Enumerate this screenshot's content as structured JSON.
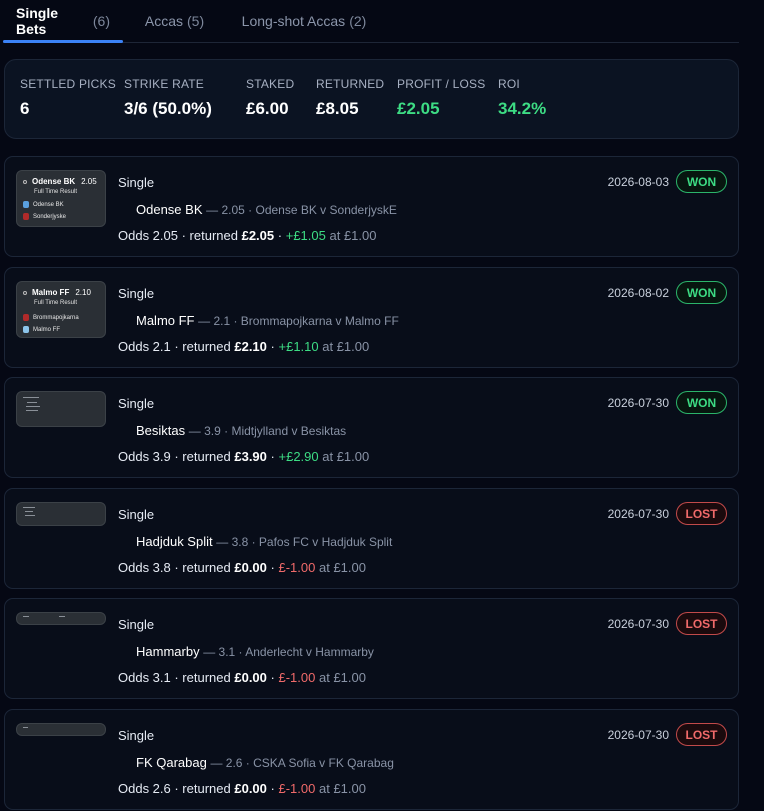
{
  "tabs": [
    {
      "label": "Single Bets",
      "count": "(6)"
    },
    {
      "label": "Accas",
      "count": "(5)"
    },
    {
      "label": "Long-shot Accas",
      "count": "(2)"
    }
  ],
  "summary": {
    "settled_label": "Settled Picks",
    "settled_value": "6",
    "strike_label": "Strike Rate",
    "strike_value": "3/6 (50.0%)",
    "staked_label": "Staked",
    "staked_value": "£6.00",
    "returned_label": "Returned",
    "returned_value": "£8.05",
    "pl_label": "Profit / Loss",
    "pl_value": "£2.05",
    "roi_label": "ROI",
    "roi_value": "34.2%"
  },
  "bets": [
    {
      "type": "Single",
      "date": "2026-08-03",
      "status": "WON",
      "selection": "Odense BK",
      "sel_odds": "— 2.05 · Odense BK v SonderjyskE",
      "odds_text": "Odds 2.05 · returned",
      "returned": "£2.05",
      "dot": "·",
      "pnl": "+£1.05",
      "stake_text": "at £1.00",
      "thumb": {
        "title": "Odense BK",
        "odds": "2.05",
        "result": "Full Time Result",
        "team1": "Odense BK",
        "team2": "Sonderjyske"
      }
    },
    {
      "type": "Single",
      "date": "2026-08-02",
      "status": "WON",
      "selection": "Malmo FF",
      "sel_odds": "— 2.1 · Brommapojkarna v Malmo FF",
      "odds_text": "Odds 2.1 · returned",
      "returned": "£2.10",
      "dot": "·",
      "pnl": "+£1.10",
      "stake_text": "at £1.00",
      "thumb": {
        "title": "Malmo FF",
        "odds": "2.10",
        "result": "Full Time Result",
        "team1": "Brommapojkarna",
        "team2": "Malmo FF"
      }
    },
    {
      "type": "Single",
      "date": "2026-07-30",
      "status": "WON",
      "selection": "Besiktas",
      "sel_odds": "— 3.9 · Midtjylland v Besiktas",
      "odds_text": "Odds 3.9 · returned",
      "returned": "£3.90",
      "dot": "·",
      "pnl": "+£2.90",
      "stake_text": "at £1.00"
    },
    {
      "type": "Single",
      "date": "2026-07-30",
      "status": "LOST",
      "selection": "Hadjduk Split",
      "sel_odds": "— 3.8 · Pafos FC v Hadjduk Split",
      "odds_text": "Odds 3.8 · returned",
      "returned": "£0.00",
      "dot": "·",
      "pnl": "£-1.00",
      "stake_text": "at £1.00"
    },
    {
      "type": "Single",
      "date": "2026-07-30",
      "status": "LOST",
      "selection": "Hammarby",
      "sel_odds": "— 3.1 · Anderlecht v Hammarby",
      "odds_text": "Odds 3.1 · returned",
      "returned": "£0.00",
      "dot": "·",
      "pnl": "£-1.00",
      "stake_text": "at £1.00"
    },
    {
      "type": "Single",
      "date": "2026-07-30",
      "status": "LOST",
      "selection": "FK Qarabag",
      "sel_odds": "— 2.6 · CSKA Sofia v FK Qarabag",
      "odds_text": "Odds 2.6 · returned",
      "returned": "£0.00",
      "dot": "·",
      "pnl": "£-1.00",
      "stake_text": "at £1.00"
    }
  ],
  "colors": {
    "won": "#3ddc84",
    "lost": "#f06a6a",
    "accent": "#3b82f6",
    "background": "#050814"
  }
}
